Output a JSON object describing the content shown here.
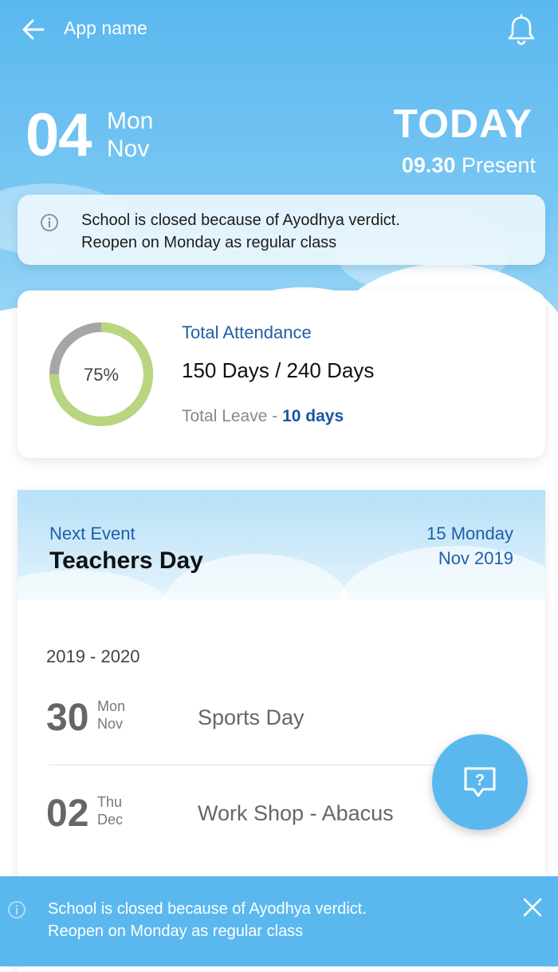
{
  "header": {
    "app_name": "App name",
    "back_icon": "arrow-left-icon",
    "bell_icon": "bell-icon"
  },
  "date": {
    "day_num": "04",
    "day_name": "Mon",
    "month": "Nov"
  },
  "today": {
    "label": "TODAY",
    "time": "09.30",
    "status": "Present"
  },
  "notice": {
    "line1": "School is closed because of Ayodhya verdict.",
    "line2": "Reopen on Monday as regular class",
    "icon": "info-icon"
  },
  "attendance": {
    "percent_label": "75%",
    "percent": 0.75,
    "title": "Total Attendance",
    "days": "150 Days / 240 Days",
    "leave_label": "Total Leave - ",
    "leave_value": "10 days"
  },
  "next_event": {
    "label": "Next Event",
    "name": "Teachers Day",
    "date_line1": "15 Monday",
    "date_line2": "Nov 2019"
  },
  "events": {
    "year_range": "2019 - 2020",
    "items": [
      {
        "num": "30",
        "day": "Mon",
        "month": "Nov",
        "title": "Sports Day"
      },
      {
        "num": "02",
        "day": "Thu",
        "month": "Dec",
        "title": "Work Shop - Abacus"
      }
    ]
  },
  "fab": {
    "icon": "help-chat-icon"
  },
  "bottom_notice": {
    "line1": "School is closed because of Ayodhya verdict.",
    "line2": "Reopen on Monday as regular class",
    "close_icon": "close-icon"
  },
  "colors": {
    "primary": "#5ab8ef",
    "accent_blue": "#1f5fa8",
    "ring_fill": "#b7d67f",
    "ring_track": "#a6a6a6"
  }
}
